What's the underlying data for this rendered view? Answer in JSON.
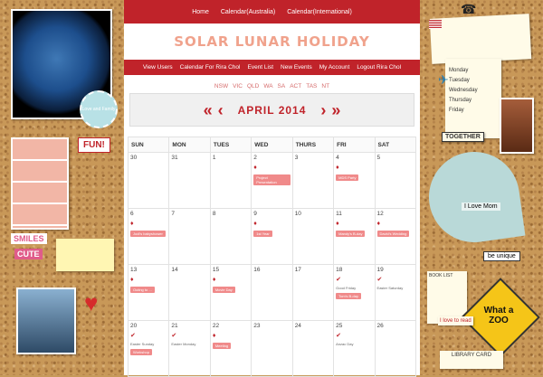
{
  "topnav": [
    "Home",
    "Calendar(Australia)",
    "Calendar(International)"
  ],
  "logo": "SOLAR LUNAR HOLIDAY",
  "subnav": [
    "View Users",
    "Calendar For Rira Chol",
    "Event List",
    "New Events",
    "My Account",
    "Logout Rira Chol"
  ],
  "states": [
    "NSW",
    "VIC",
    "QLD",
    "WA",
    "SA",
    "ACT",
    "TAS",
    "NT"
  ],
  "month": {
    "title": "APRIL 2014",
    "prev_icon": "double-left-arrow",
    "prev_month_icon": "left-arrow",
    "next_icon": "right-arrow",
    "next_month_icon": "double-right-arrow"
  },
  "days": [
    "SUN",
    "MON",
    "TUES",
    "WED",
    "THURS",
    "FRI",
    "SAT"
  ],
  "calendar": [
    [
      {
        "d": "30"
      },
      {
        "d": "31"
      },
      {
        "d": "1"
      },
      {
        "d": "2",
        "ev": "Project Presentation"
      },
      {
        "d": "3"
      },
      {
        "d": "4",
        "ev": "MDS Party"
      },
      {
        "d": "5"
      }
    ],
    [
      {
        "d": "6",
        "ev": "Jodi's babyshower"
      },
      {
        "d": "7"
      },
      {
        "d": "8"
      },
      {
        "d": "9",
        "ev": "1st Year"
      },
      {
        "d": "10"
      },
      {
        "d": "11",
        "ev": "Mandy's B-day"
      },
      {
        "d": "12",
        "ev": "David's Wedding"
      }
    ],
    [
      {
        "d": "13",
        "ev": "Outing to ..."
      },
      {
        "d": "14"
      },
      {
        "d": "15",
        "ev": "Movie Day"
      },
      {
        "d": "16"
      },
      {
        "d": "17"
      },
      {
        "d": "18",
        "plain": "Good Friday",
        "ev": "Tom's B-day"
      },
      {
        "d": "19",
        "plain": "Easter Saturday"
      }
    ],
    [
      {
        "d": "20",
        "plain": "Easter Sunday",
        "ev": "Workshop"
      },
      {
        "d": "21",
        "plain": "Easter Monday"
      },
      {
        "d": "22",
        "ev": "Meeting"
      },
      {
        "d": "23"
      },
      {
        "d": "24"
      },
      {
        "d": "25",
        "plain": "Anzac Day"
      },
      {
        "d": "26"
      }
    ]
  ],
  "decor": {
    "left_tag": "Love and Family",
    "fun": "FUN!",
    "smiles": "SMILES",
    "cute": "CUTE",
    "right_together": "TOGETHER",
    "right_love_mom": "I Love Mom",
    "right_be_unique": "be unique",
    "right_zoo": "What a ZOO",
    "right_book_list": "BOOK LIST",
    "right_love_read": "I love to read",
    "right_library": "LIBRARY CARD",
    "memo_days": [
      "Monday",
      "Tuesday",
      "Wednesday",
      "Thursday",
      "Friday"
    ]
  },
  "colors": {
    "accent": "#c0232a",
    "event": "#f08a8a",
    "logo": "#f0a28c"
  }
}
